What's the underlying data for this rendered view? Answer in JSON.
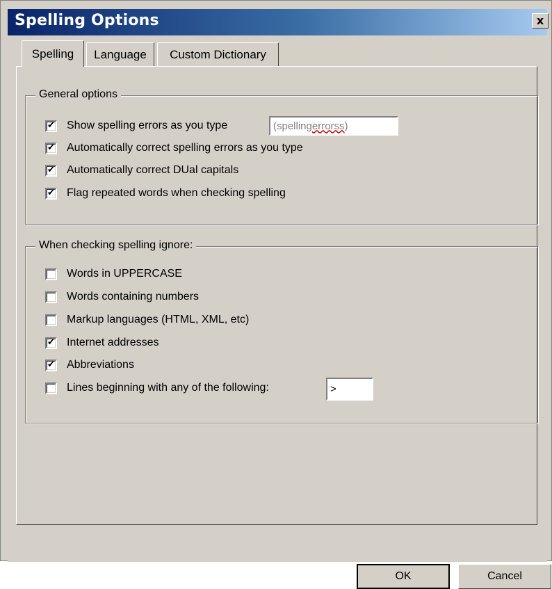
{
  "window": {
    "title": "Spelling Options",
    "close_label": "x"
  },
  "tabs": [
    "Spelling",
    "Language",
    "Custom Dictionary"
  ],
  "general": {
    "title": "General options",
    "items": [
      {
        "label": "Show spelling errors as you type",
        "checked": true
      },
      {
        "label": "Automatically correct spelling errors as you type",
        "checked": true
      },
      {
        "label": "Automatically correct DUal capitals",
        "checked": true
      },
      {
        "label": "Flag repeated words when checking spelling",
        "checked": true
      }
    ],
    "sample_prefix": "(spelling ",
    "sample_word": "errorss",
    "sample_suffix": ")"
  },
  "ignore": {
    "title": "When checking spelling ignore:",
    "items": [
      {
        "label": "Words in UPPERCASE",
        "checked": false
      },
      {
        "label": "Words containing numbers",
        "checked": false
      },
      {
        "label": "Markup languages (HTML, XML, etc)",
        "checked": false
      },
      {
        "label": "Internet addresses",
        "checked": true
      },
      {
        "label": "Abbreviations",
        "checked": true
      },
      {
        "label": "Lines beginning with any of the following:",
        "checked": false
      }
    ],
    "prefix_value": ">"
  },
  "buttons": {
    "ok": "OK",
    "cancel": "Cancel"
  },
  "icons": {
    "close": "close-icon",
    "checkbox": "checkmark-icon"
  }
}
